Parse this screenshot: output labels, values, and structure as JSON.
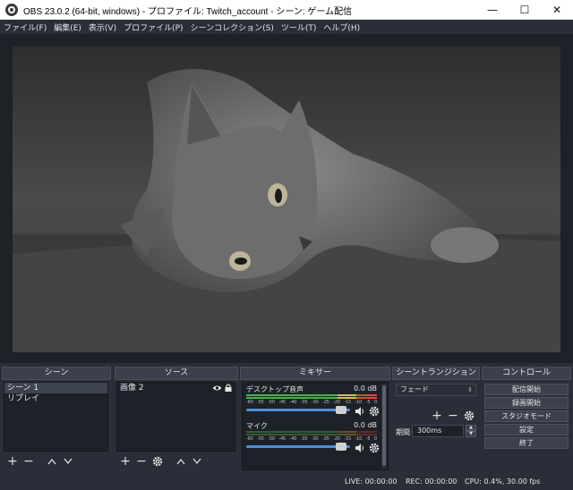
{
  "window": {
    "title": "OBS 23.0.2 (64-bit, windows) - プロファイル: Twitch_account - シーン: ゲーム配信",
    "minimize": "—",
    "maximize": "☐",
    "close": "✕"
  },
  "menu": [
    "ファイル(F)",
    "編集(E)",
    "表示(V)",
    "プロファイル(P)",
    "シーンコレクション(S)",
    "ツール(T)",
    "ヘルプ(H)"
  ],
  "docks": {
    "scenes": {
      "title": "シーン",
      "items": [
        "シーン 1",
        "リプレイ"
      ]
    },
    "sources": {
      "title": "ソース",
      "items": [
        {
          "name": "画像 2",
          "visible_icon": "eye-icon",
          "lock_icon": "lock-icon"
        }
      ]
    },
    "mixer": {
      "title": "ミキサー",
      "channels": [
        {
          "name": "デスクトップ音声",
          "db": "0.0 dB",
          "level": 0.78
        },
        {
          "name": "マイク",
          "db": "0.0 dB",
          "level": 0.0
        }
      ],
      "ticks": [
        "-60",
        "-55",
        "-50",
        "-45",
        "-40",
        "-35",
        "-30",
        "-25",
        "-20",
        "-15",
        "-10",
        "-5",
        "0"
      ]
    },
    "transitions": {
      "title": "シーントランジション",
      "selected": "フェード",
      "duration_label": "期間",
      "duration": "300ms"
    },
    "controls": {
      "title": "コントロール",
      "buttons": [
        "配信開始",
        "録画開始",
        "スタジオモード",
        "設定",
        "終了"
      ]
    }
  },
  "status": {
    "live": "LIVE: 00:00:00",
    "rec": "REC: 00:00:00",
    "cpu": "CPU: 0.4%, 30.00 fps"
  },
  "colors": {
    "background": "#2b2e38",
    "panel": "#1f2129",
    "meter_green": "#4caf50",
    "meter_yellow": "#d6c23a",
    "meter_red": "#d84a3a",
    "slider": "#4a90d9"
  }
}
